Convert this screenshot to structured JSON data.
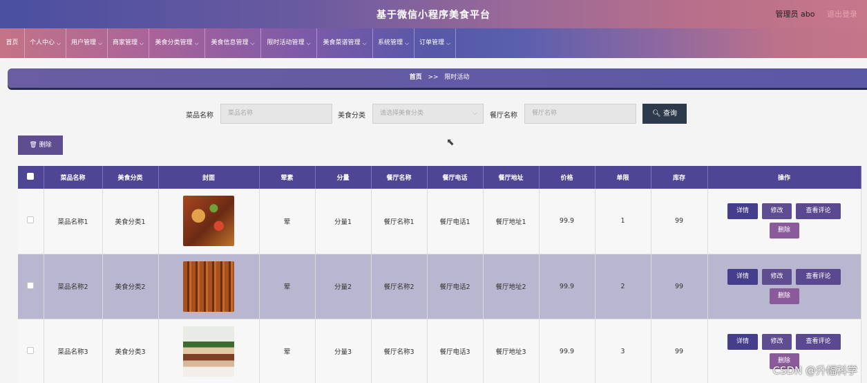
{
  "header": {
    "title": "基于微信小程序美食平台",
    "user": "管理员 abo",
    "logout": "退出登录"
  },
  "nav": {
    "items": [
      {
        "label": "首页",
        "dropdown": false
      },
      {
        "label": "个人中心",
        "dropdown": true
      },
      {
        "label": "用户管理",
        "dropdown": true
      },
      {
        "label": "商家管理",
        "dropdown": true
      },
      {
        "label": "美食分类管理",
        "dropdown": true
      },
      {
        "label": "美食信息管理",
        "dropdown": true
      },
      {
        "label": "限时活动管理",
        "dropdown": true
      },
      {
        "label": "美食菜谱管理",
        "dropdown": true
      },
      {
        "label": "系统管理",
        "dropdown": true
      },
      {
        "label": "订单管理",
        "dropdown": true
      }
    ]
  },
  "breadcrumb": {
    "home": "首页",
    "separator": ">>",
    "current": "限时活动"
  },
  "search": {
    "dish_label": "菜品名称",
    "dish_placeholder": "菜品名称",
    "category_label": "美食分类",
    "category_placeholder": "请选择美食分类",
    "restaurant_label": "餐厅名称",
    "restaurant_placeholder": "餐厅名称",
    "query_button": "查询"
  },
  "actions": {
    "delete_button": "删除"
  },
  "table": {
    "headers": [
      "菜品名称",
      "美食分类",
      "封面",
      "荤素",
      "分量",
      "餐厅名称",
      "餐厅电话",
      "餐厅地址",
      "价格",
      "单限",
      "库存",
      "操作"
    ],
    "rows": [
      {
        "name": "菜品名称1",
        "category": "美食分类1",
        "meat": "荤",
        "portion": "分量1",
        "restaurant": "餐厅名称1",
        "phone": "餐厅电话1",
        "address": "餐厅地址1",
        "price": "99.9",
        "limit": "1",
        "stock": "99"
      },
      {
        "name": "菜品名称2",
        "category": "美食分类2",
        "meat": "荤",
        "portion": "分量2",
        "restaurant": "餐厅名称2",
        "phone": "餐厅电话2",
        "address": "餐厅地址2",
        "price": "99.9",
        "limit": "2",
        "stock": "99"
      },
      {
        "name": "菜品名称3",
        "category": "美食分类3",
        "meat": "荤",
        "portion": "分量3",
        "restaurant": "餐厅名称3",
        "phone": "餐厅电话3",
        "address": "餐厅地址3",
        "price": "99.9",
        "limit": "3",
        "stock": "99"
      }
    ],
    "op_labels": {
      "detail": "详情",
      "edit": "修改",
      "review": "查看评论",
      "delete": "删除"
    }
  },
  "watermark": "CSDN @升幅科学",
  "colors": {
    "header_dark": "#4e4594",
    "button_primary": "#5f4d92",
    "search_button": "#2c3a4c",
    "hover_row": "#b9b6cf"
  }
}
